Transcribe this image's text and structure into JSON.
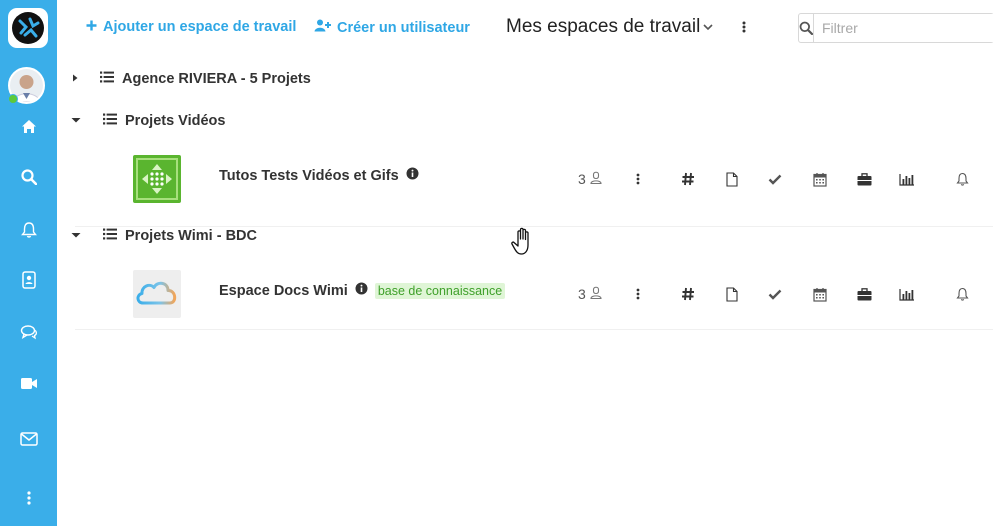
{
  "sidebar": {
    "logo_icon": "wimi-logo-icon",
    "avatar_icon": "user-avatar",
    "status_color": "#5cc93b",
    "accent_color": "#3aaee9",
    "items": [
      {
        "name": "home-icon"
      },
      {
        "name": "search-icon"
      },
      {
        "name": "bell-icon"
      },
      {
        "name": "contacts-icon"
      },
      {
        "name": "chat-icon"
      },
      {
        "name": "video-icon"
      },
      {
        "name": "mail-icon"
      },
      {
        "name": "more-vertical-icon"
      }
    ]
  },
  "toolbar": {
    "add_workspace_label": "Ajouter un espace de travail",
    "create_user_label": "Créer un utilisateur",
    "title": "Mes espaces de travail",
    "filter_placeholder": "Filtrer"
  },
  "groups": [
    {
      "label": "Agence RIVIERA - 5 Projets",
      "expanded": false
    },
    {
      "label": "Projets Vidéos",
      "expanded": true
    },
    {
      "label": "Projets Wimi - BDC",
      "expanded": true
    }
  ],
  "workspaces": [
    {
      "name": "Tutos Tests Vidéos et Gifs",
      "members": "3",
      "badge": "",
      "thumb_color": "#5ab52f"
    },
    {
      "name": "Espace Docs Wimi",
      "members": "3",
      "badge": "base de connaissance",
      "thumb_color": "#eeeeee"
    }
  ],
  "workspace_tools": [
    "more-vertical-icon",
    "hashtag-icon",
    "document-icon",
    "check-icon",
    "calendar-icon",
    "briefcase-icon",
    "bar-chart-icon",
    "bell-icon"
  ]
}
